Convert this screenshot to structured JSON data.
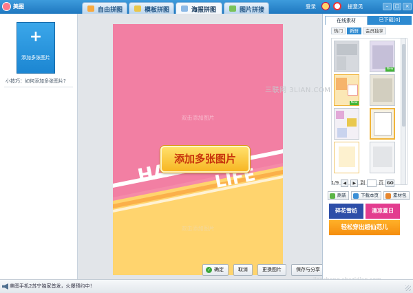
{
  "window": {
    "title": "美图"
  },
  "tabs": [
    {
      "label": "自由拼图",
      "icon": "free-puzzle-icon"
    },
    {
      "label": "模板拼图",
      "icon": "template-puzzle-icon"
    },
    {
      "label": "海报拼图",
      "icon": "poster-puzzle-icon",
      "active": true
    },
    {
      "label": "图片拼接",
      "icon": "image-stitch-icon"
    }
  ],
  "titlebar_links": {
    "login": "登录",
    "feedback": "提意见"
  },
  "left_panel": {
    "add_button_label": "添加多张图片",
    "tip": "小技巧：如何添加多张图片?"
  },
  "poster": {
    "placeholder_top": "双击添加图片",
    "placeholder_bottom": "双击添加图片",
    "add_button_label": "添加多张图片",
    "deco_text_1": "HAPP",
    "deco_text_2": "LIFE"
  },
  "actions": {
    "confirm": "确定",
    "cancel": "取消",
    "replace": "更换图片",
    "save_share": "保存与分享"
  },
  "right_panel": {
    "tab_online": "在线素材",
    "tab_downloaded": "已下载[0]",
    "subtabs": [
      "热门",
      "新鲜",
      "会员独享"
    ],
    "thumb_badge": "New",
    "pager": {
      "current": "1/9",
      "goto_label": "到",
      "page_unit": "页",
      "go": "GO"
    },
    "tools": {
      "refresh": "刷新",
      "download_page": "下载本页",
      "material_pack": "素材包"
    },
    "banners": {
      "b1": "碎花雪纺",
      "b2": "清凉夏日",
      "b3": "轻松穿出超仙范儿"
    }
  },
  "watermarks": {
    "top": "三联网 3LIAN.COM",
    "bottom": "jiaocheng.chazidian.com"
  },
  "status": {
    "text": "美图手机2苏宁独家首发，火爆预约中！"
  },
  "colors": {
    "poster_pink": "#f27fa3",
    "poster_yellow": "#ffd46e",
    "accent_blue": "#2d8ad1"
  }
}
